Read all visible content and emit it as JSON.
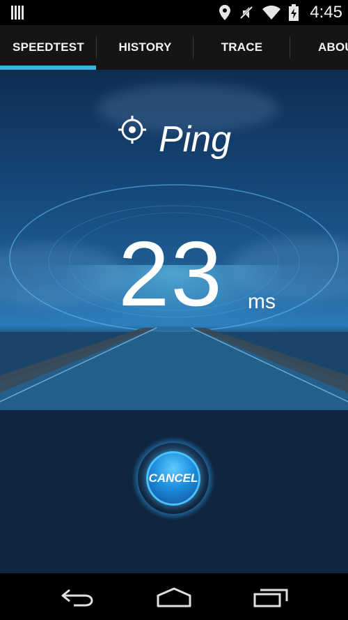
{
  "status_bar": {
    "time": "4:45",
    "icons": [
      "signal-strength-icon",
      "location-icon",
      "mute-icon",
      "wifi-icon",
      "battery-charging-icon"
    ]
  },
  "tabs": [
    {
      "label": "SPEEDTEST",
      "active": true
    },
    {
      "label": "HISTORY",
      "active": false
    },
    {
      "label": "TRACE",
      "active": false
    },
    {
      "label": "ABOU",
      "active": false
    }
  ],
  "test": {
    "title": "Ping",
    "value": "23",
    "unit": "ms",
    "icon": "crosshair-icon"
  },
  "cancel_button": {
    "label": "CANCEL"
  },
  "nav_bar": {
    "icons": [
      "back-icon",
      "home-icon",
      "recent-apps-icon"
    ]
  },
  "colors": {
    "accent": "#34b5e5",
    "tab_bar": "#151515",
    "lower_panel": "#102640"
  }
}
